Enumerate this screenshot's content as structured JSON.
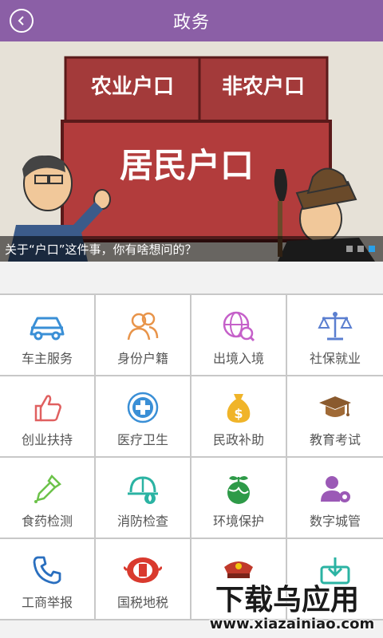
{
  "header": {
    "title": "政务"
  },
  "banner": {
    "caption": "关于“户口”这件事，你有啥想问的？",
    "slide_count": 3,
    "active_slide": 3,
    "sign_left": "农业户口",
    "sign_right": "非农户口",
    "sign_center": "居民户口"
  },
  "services": [
    {
      "label": "车主服务",
      "icon": "car-icon"
    },
    {
      "label": "身份户籍",
      "icon": "people-icon"
    },
    {
      "label": "出境入境",
      "icon": "globe-icon"
    },
    {
      "label": "社保就业",
      "icon": "scale-icon"
    },
    {
      "label": "创业扶持",
      "icon": "thumbs-up-icon"
    },
    {
      "label": "医疗卫生",
      "icon": "medical-cross-icon"
    },
    {
      "label": "民政补助",
      "icon": "money-bag-icon"
    },
    {
      "label": "教育考试",
      "icon": "graduation-cap-icon"
    },
    {
      "label": "食药检测",
      "icon": "dropper-icon"
    },
    {
      "label": "消防检查",
      "icon": "fire-helmet-icon"
    },
    {
      "label": "环境保护",
      "icon": "earth-plant-icon"
    },
    {
      "label": "数字城管",
      "icon": "user-gear-icon"
    },
    {
      "label": "工商举报",
      "icon": "phone-icon"
    },
    {
      "label": "国税地税",
      "icon": "tax-emblem-icon"
    },
    {
      "label": "",
      "icon": "police-hat-icon"
    },
    {
      "label": "",
      "icon": "download-icon"
    }
  ],
  "watermark": {
    "main": "下载乌应用",
    "url": "www.xiazainiao.com"
  }
}
